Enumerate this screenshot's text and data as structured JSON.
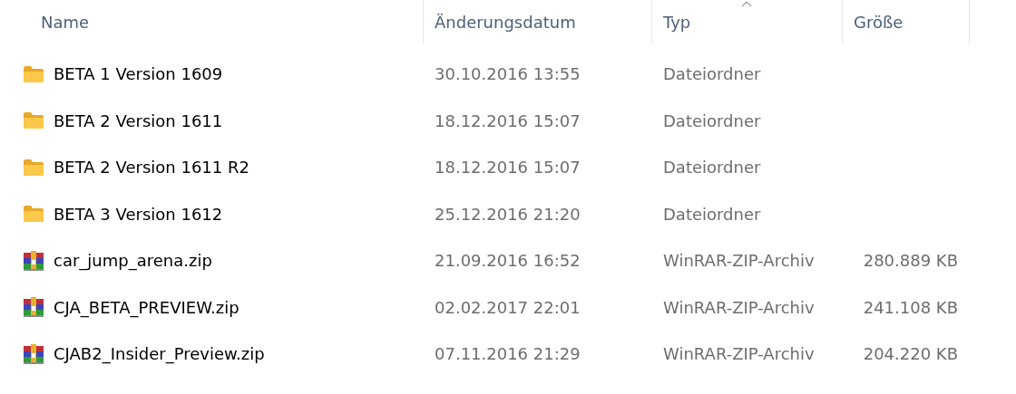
{
  "columns": [
    {
      "label": "Name",
      "sorted": false
    },
    {
      "label": "Änderungsdatum",
      "sorted": false
    },
    {
      "label": "Typ",
      "sorted": true
    },
    {
      "label": "Größe",
      "sorted": false
    }
  ],
  "rows": [
    {
      "kind": "folder",
      "name": "BETA 1 Version 1609",
      "date": "30.10.2016 13:55",
      "type": "Dateiordner"
    },
    {
      "kind": "folder",
      "name": "BETA 2 Version 1611",
      "date": "18.12.2016 15:07",
      "type": "Dateiordner"
    },
    {
      "kind": "folder",
      "name": "BETA 2 Version 1611 R2",
      "date": "18.12.2016 15:07",
      "type": "Dateiordner"
    },
    {
      "kind": "folder",
      "name": "BETA 3 Version 1612",
      "date": "25.12.2016 21:20",
      "type": "Dateiordner"
    },
    {
      "kind": "archive",
      "name": "car_jump_arena.zip",
      "date": "21.09.2016 16:52",
      "type": "WinRAR-ZIP-Archiv",
      "size": "280.889 KB"
    },
    {
      "kind": "archive",
      "name": "CJA_BETA_PREVIEW.zip",
      "date": "02.02.2017 22:01",
      "type": "WinRAR-ZIP-Archiv",
      "size": "241.108 KB"
    },
    {
      "kind": "archive",
      "name": "CJAB2_Insider_Preview.zip",
      "date": "07.11.2016 21:29",
      "type": "WinRAR-ZIP-Archiv",
      "size": "204.220 KB"
    }
  ]
}
